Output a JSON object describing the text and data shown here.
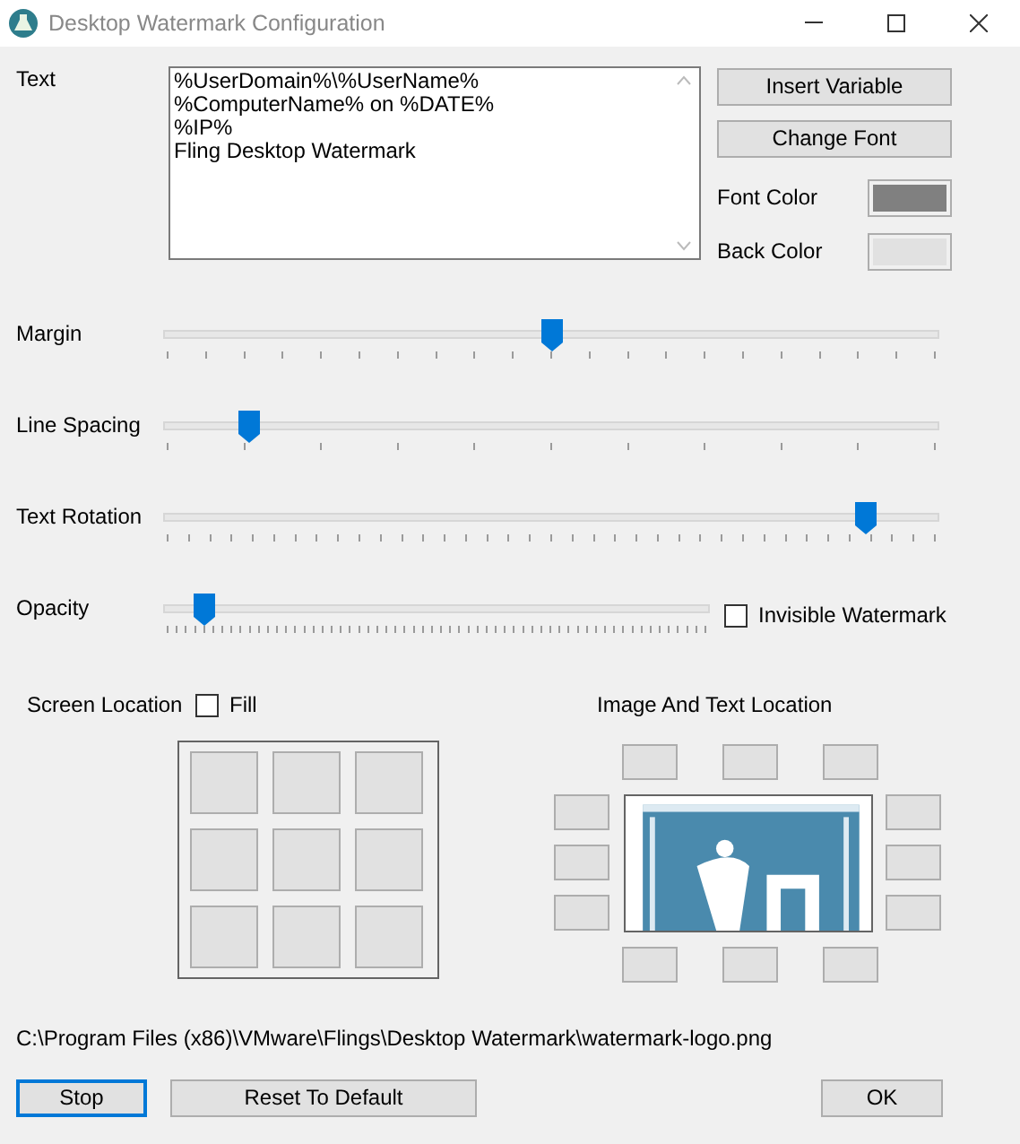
{
  "window": {
    "title": "Desktop Watermark Configuration"
  },
  "text": {
    "label": "Text",
    "value": "%UserDomain%\\%UserName%\n%ComputerName% on %DATE%\n%IP%\nFling Desktop Watermark"
  },
  "side_buttons": [
    {
      "label": "Insert Variable"
    },
    {
      "label": "Change Font"
    }
  ],
  "colors": [
    {
      "label": "Font Color",
      "color": "#808080"
    },
    {
      "label": "Back Color",
      "color": "#e1e1e1"
    }
  ],
  "sliders": [
    {
      "label": "Margin",
      "level": 0.5
    },
    {
      "label": "Line Spacing",
      "level": 0.11
    },
    {
      "label": "Text Rotation",
      "level": 0.905
    },
    {
      "label": "Opacity",
      "level": 0.076
    }
  ],
  "invisible_watermark": {
    "label": "Invisible Watermark",
    "checked": false
  },
  "screen_location": {
    "label": "Screen Location",
    "fill": {
      "label": "Fill",
      "checked": false
    }
  },
  "image_location": {
    "label": "Image And Text Location"
  },
  "path": "C:\\Program Files (x86)\\VMware\\Flings\\Desktop Watermark\\watermark-logo.png",
  "footer_buttons": [
    {
      "label": "Stop",
      "focused": true
    },
    {
      "label": "Reset To Default",
      "focused": false
    },
    {
      "label": "OK",
      "focused": false
    }
  ]
}
